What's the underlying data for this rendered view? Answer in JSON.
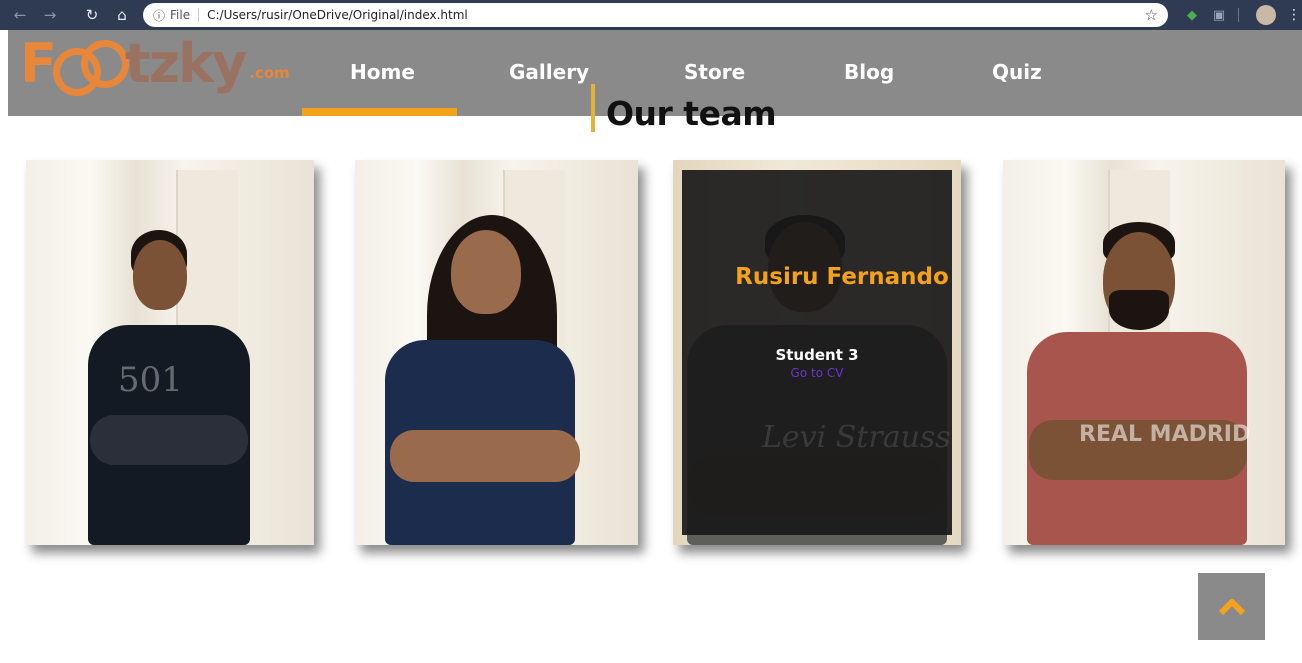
{
  "browser": {
    "scheme_label": "File",
    "url": "C:/Users/rusir/OneDrive/Original/index.html",
    "icons": [
      "back-icon",
      "forward-icon",
      "reload-icon",
      "home-icon",
      "info-icon",
      "star-icon",
      "extension-icon",
      "pdf-extension-icon",
      "profile-avatar",
      "menu-icon"
    ]
  },
  "nav": {
    "logo": {
      "text_f": "F",
      "text_tzky": "tzky",
      "text_com": ".com"
    },
    "links": [
      "Home",
      "Gallery",
      "Store",
      "Blog",
      "Quiz"
    ],
    "active": "Home",
    "accent_color": "#f5a21b",
    "bar_color": "#8a8a8a"
  },
  "section": {
    "title": "Our team"
  },
  "team": [
    {
      "shirt_color": "#141a24",
      "shirt_text": "501"
    },
    {
      "shirt_color": "#1c2c4d",
      "shirt_text": ""
    },
    {
      "name": "Rusiru Fernando",
      "role": "Student 3",
      "link_label": "Go to CV",
      "shirt_color": "#5e5e5a",
      "shirt_text": "Levi Strauss"
    },
    {
      "shirt_color": "#a8554e",
      "shirt_text": "REAL MADRID"
    }
  ],
  "back_to_top": {
    "icon": "chevron-up-icon",
    "color": "#f5a21b"
  }
}
